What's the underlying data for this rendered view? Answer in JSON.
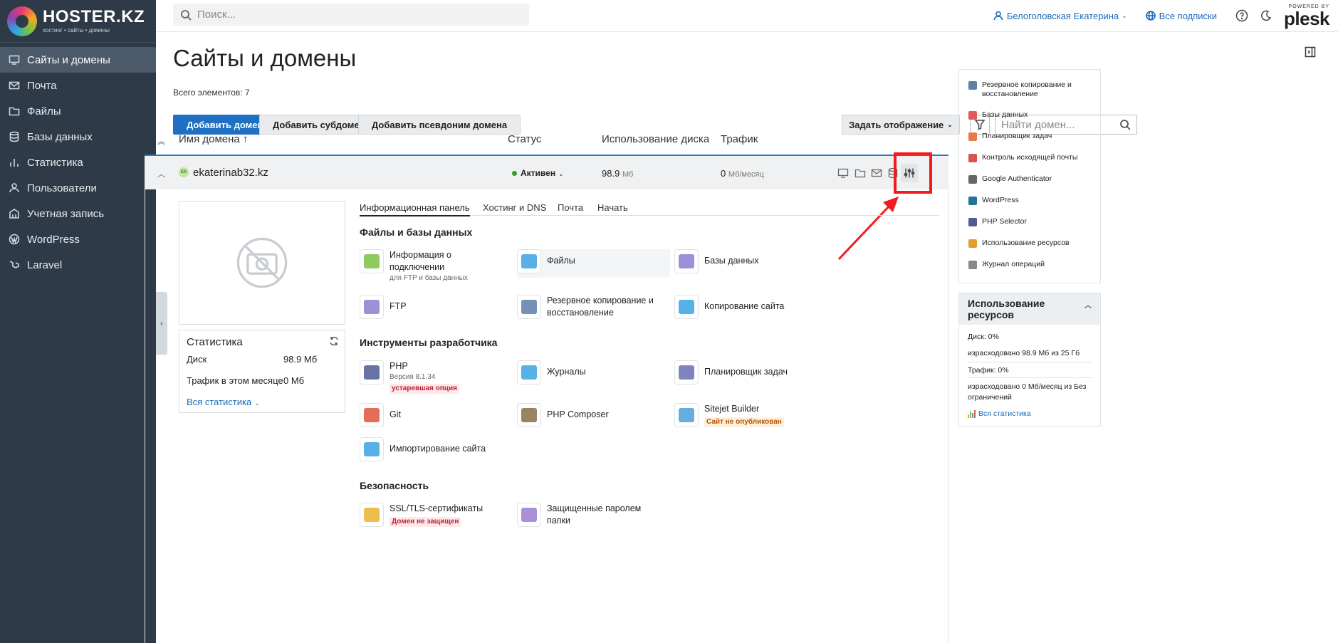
{
  "brand": {
    "name_a": "HOSTER.",
    "name_b": "KZ",
    "tagline": "хостинг • сайты • домены"
  },
  "sidebar": {
    "items": [
      {
        "label": "Сайты и домены",
        "icon": "monitor-icon",
        "active": true
      },
      {
        "label": "Почта",
        "icon": "mail-icon"
      },
      {
        "label": "Файлы",
        "icon": "folder-icon"
      },
      {
        "label": "Базы данных",
        "icon": "database-icon"
      },
      {
        "label": "Статистика",
        "icon": "bar-chart-icon"
      },
      {
        "label": "Пользователи",
        "icon": "user-icon"
      },
      {
        "label": "Учетная запись",
        "icon": "account-icon"
      },
      {
        "label": "WordPress",
        "icon": "wordpress-icon"
      },
      {
        "label": "Laravel",
        "icon": "laravel-icon"
      }
    ]
  },
  "topbar": {
    "search_placeholder": "Поиск...",
    "user": "Белоголовская Екатерина",
    "subscriptions": "Все подписки",
    "powered_by": "POWERED BY",
    "plesk": "plesk"
  },
  "page": {
    "title": "Сайты и домены",
    "total": "Всего элементов: 7",
    "buttons": {
      "add_domain": "Добавить домен",
      "add_subdomain": "Добавить субдомен",
      "add_alias": "Добавить псевдоним домена",
      "view": "Задать отображение"
    },
    "find_placeholder": "Найти домен..."
  },
  "table": {
    "headers": {
      "name": "Имя домена ↑",
      "status": "Статус",
      "disk": "Использование диска",
      "traffic": "Трафик"
    },
    "row": {
      "domain": "ekaterinab32.kz",
      "status": "Активен",
      "disk_value": "98.9",
      "disk_unit": "Мб",
      "traffic_value": "0",
      "traffic_unit": "Мб/месяц"
    }
  },
  "stats": {
    "title": "Статистика",
    "disk_label": "Диск",
    "disk_value": "98.9 Мб",
    "traffic_label": "Трафик в этом месяце",
    "traffic_value": "0 Мб",
    "all": "Вся статистика"
  },
  "tabs": [
    "Информационная панель",
    "Хостинг и DNS",
    "Почта",
    "Начать"
  ],
  "sections": {
    "files": "Файлы и базы данных",
    "dev": "Инструменты разработчика",
    "security": "Безопасность"
  },
  "tools": {
    "conn": {
      "label": "Информация о подключении",
      "sub": "для FTP и базы данных"
    },
    "files": {
      "label": "Файлы"
    },
    "db": {
      "label": "Базы данных"
    },
    "ftp": {
      "label": "FTP"
    },
    "backup": {
      "label": "Резервное копирование и восстановление"
    },
    "copy": {
      "label": "Копирование сайта"
    },
    "php": {
      "label": "PHP",
      "sub": "Версия 8.1.34",
      "badge": "устаревшая опция"
    },
    "logs": {
      "label": "Журналы"
    },
    "sched": {
      "label": "Планировщик задач"
    },
    "git": {
      "label": "Git"
    },
    "composer": {
      "label": "PHP Composer"
    },
    "sitejet": {
      "label": "Sitejet Builder",
      "badge": "Сайт не опубликован"
    },
    "import": {
      "label": "Импортирование сайта"
    },
    "ssl": {
      "label": "SSL/TLS-сертификаты",
      "badge": "Домен не защищен"
    },
    "protect": {
      "label": "Защищенные паролем папки"
    }
  },
  "right_panel": {
    "items": [
      {
        "label": "Резервное копирование и восстановление",
        "color": "#5a7fa8"
      },
      {
        "label": "Базы данных",
        "color": "#e05a5a"
      },
      {
        "label": "Планировщик задач",
        "color": "#e8794a"
      },
      {
        "label": "Контроль исходящей почты",
        "color": "#d9534f"
      },
      {
        "label": "Google Authenticator",
        "color": "#666666"
      },
      {
        "label": "WordPress",
        "color": "#21759b"
      },
      {
        "label": "PHP Selector",
        "color": "#4f5b93"
      },
      {
        "label": "Использование ресурсов",
        "color": "#e0a030"
      },
      {
        "label": "Журнал операций",
        "color": "#8a8a8a"
      }
    ]
  },
  "usage": {
    "title": "Использование ресурсов",
    "disk": "Диск: 0%",
    "disk_detail": "израсходовано 98.9 Мб из 25 Гб",
    "traffic": "Трафик: 0%",
    "traffic_detail": "израсходовано 0 Мб/месяц из Без ограничений",
    "all": "Вся статистика"
  },
  "colors": {
    "sidebar": "#2e3a48",
    "primary": "#1f6fc2",
    "highlight": "#f31b1b"
  }
}
